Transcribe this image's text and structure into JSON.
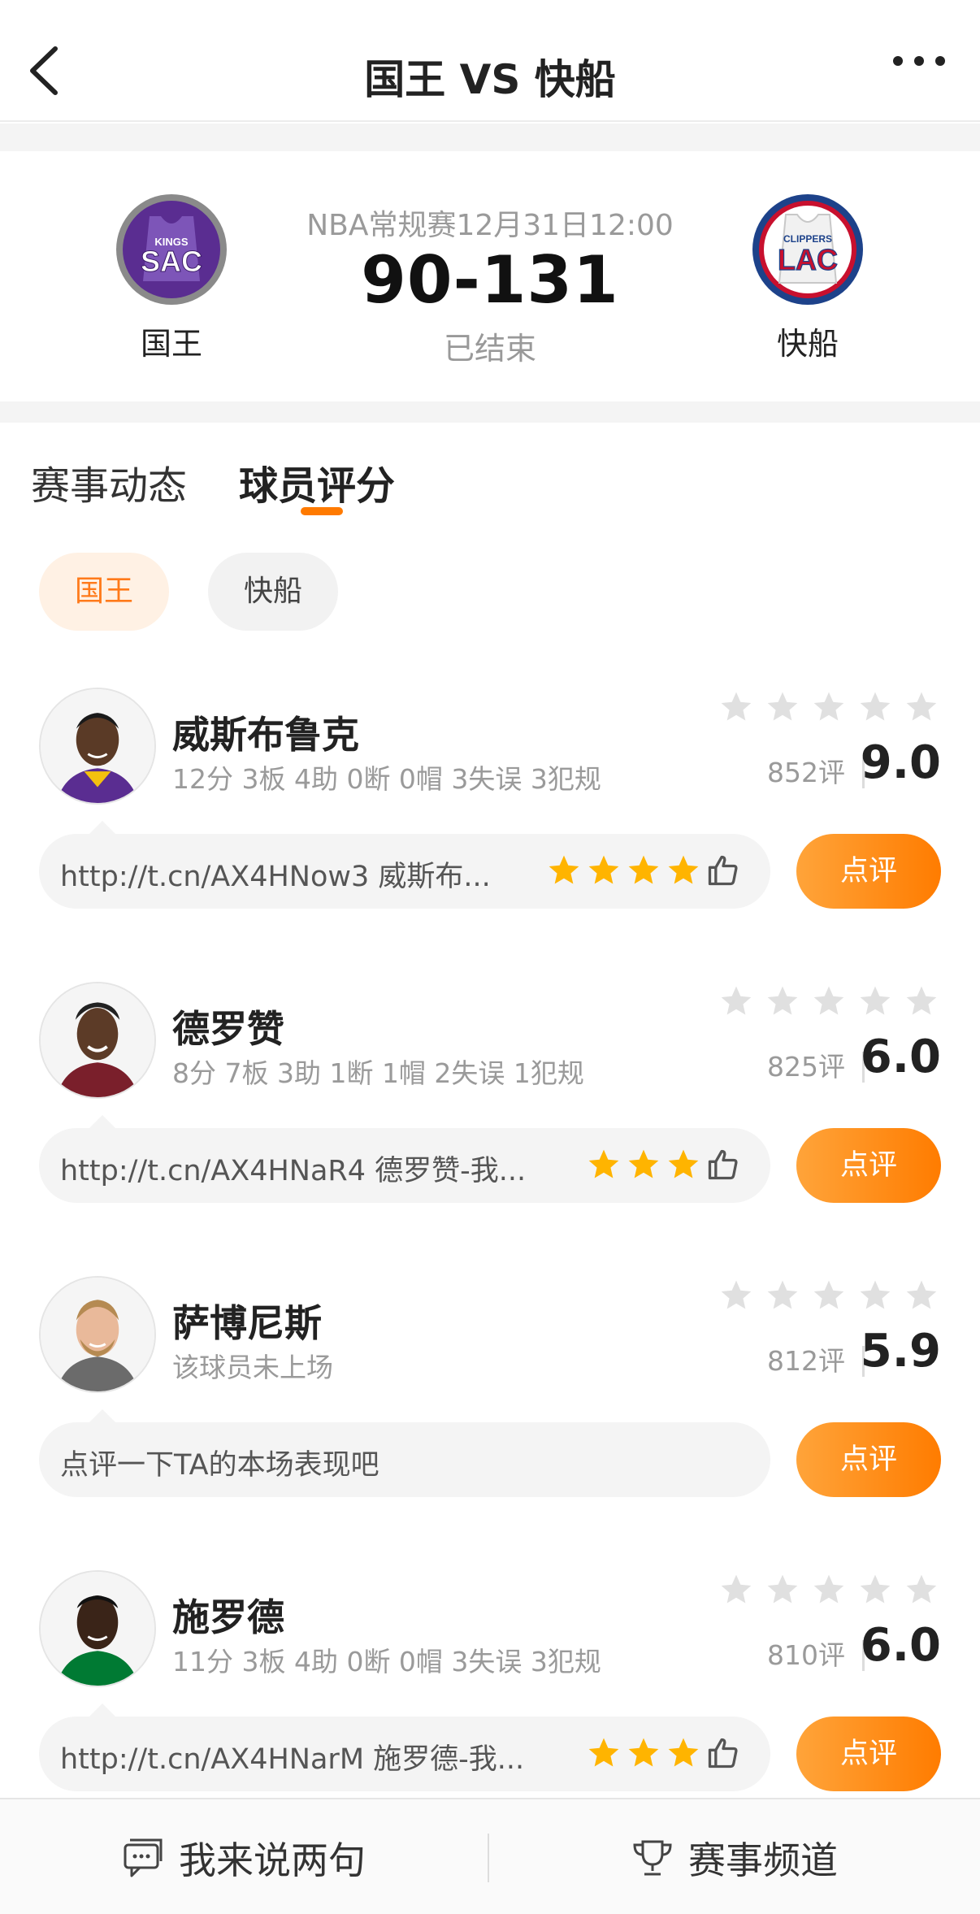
{
  "nav": {
    "title": "国王 VS 快船"
  },
  "match": {
    "home_team": "国王",
    "home_logo_text": "SAC",
    "home_logo_sub": "KINGS",
    "away_team": "快船",
    "away_logo_text": "LAC",
    "away_logo_sub": "CLIPPERS",
    "meta": "NBA常规赛12月31日12:00",
    "score": "90-131",
    "status": "已结束"
  },
  "tabs": [
    "赛事动态",
    "球员评分"
  ],
  "team_filter": {
    "active": "国王",
    "inactive": "快船"
  },
  "review_label": "点评",
  "players": [
    {
      "name": "威斯布鲁克",
      "stats": "12分 3板 4助 0断 0帽 3失误 3犯规",
      "count": "852评",
      "rating": "9.0",
      "comment": "http://t.cn/AX4HNow3 威斯布...",
      "comment_stars": 4,
      "has_like": true
    },
    {
      "name": "德罗赞",
      "stats": "8分 7板 3助 1断 1帽 2失误 1犯规",
      "count": "825评",
      "rating": "6.0",
      "comment": "http://t.cn/AX4HNaR4 德罗赞-我...",
      "comment_stars": 3,
      "has_like": true
    },
    {
      "name": "萨博尼斯",
      "stats": "该球员未上场",
      "count": "812评",
      "rating": "5.9",
      "comment": "点评一下TA的本场表现吧",
      "comment_stars": 0,
      "has_like": false
    },
    {
      "name": "施罗德",
      "stats": "11分 3板 4助 0断 0帽 3失误 3犯规",
      "count": "810评",
      "rating": "6.0",
      "comment": "http://t.cn/AX4HNarM 施罗德-我...",
      "comment_stars": 3,
      "has_like": true
    }
  ],
  "bottom": {
    "left_label": "我来说两句",
    "right_label": "赛事频道"
  },
  "colors": {
    "accent": "#ff7a00",
    "star_empty": "#e0e0e0",
    "star_filled": "#ffb400"
  },
  "icons": [
    "back-arrow-icon",
    "more-dots-icon",
    "star-icon",
    "thumbs-up-icon",
    "comment-icon",
    "trophy-icon"
  ]
}
